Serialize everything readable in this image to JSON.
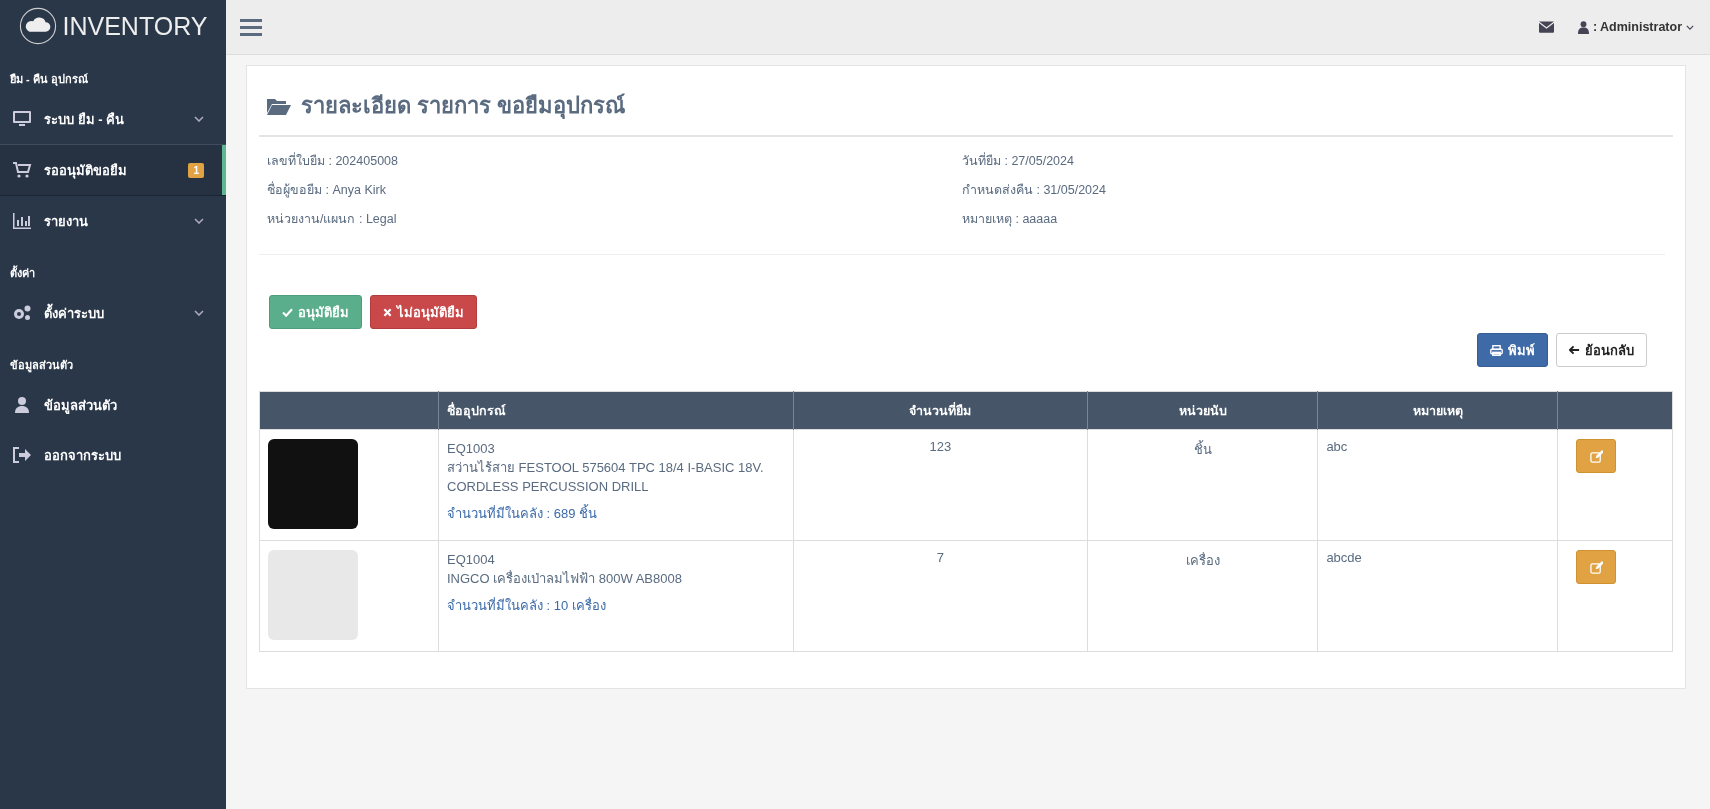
{
  "brand": "INVENTORY",
  "sidebar": {
    "sections": [
      {
        "title": "ยืม - คืน อุปกรณ์",
        "items": [
          {
            "label": "ระบบ ยืม - คืน",
            "kind": "dropdown",
            "selected": false
          },
          {
            "label": "รออนุมัติขอยืม",
            "kind": "link",
            "selected": true,
            "badge": "1"
          },
          {
            "label": "รายงาน",
            "kind": "dropdown",
            "selected": false
          }
        ]
      },
      {
        "title": "ตั้งค่า",
        "items": [
          {
            "label": "ตั้งค่าระบบ",
            "kind": "dropdown",
            "selected": false
          }
        ]
      },
      {
        "title": "ข้อมูลส่วนตัว",
        "items": [
          {
            "label": "ข้อมูลส่วนตัว",
            "kind": "link",
            "selected": false
          },
          {
            "label": "ออกจากระบบ",
            "kind": "link",
            "selected": false
          }
        ]
      }
    ]
  },
  "topbar": {
    "user": ": Administrator"
  },
  "page": {
    "title": "รายละเอียด รายการ ขอยืมอุปกรณ์",
    "details_left": [
      "เลขที่ใบยืม : 202405008",
      "ชื่อผู้ขอยืม : Anya Kirk",
      "หน่วยงาน/แผนก : Legal"
    ],
    "details_right": [
      "วันที่ยืม : 27/05/2024",
      "กำหนดส่งคืน : 31/05/2024",
      "หมายเหตุ : aaaaa"
    ],
    "approve_button": "อนุมัติยืม",
    "reject_button": "ไม่อนุมัติยืม",
    "print_button": "พิมพ์",
    "back_button": "ย้อนกลับ"
  },
  "table": {
    "columns": [
      "ชื่ออุปกรณ์",
      "จำนวนที่ยืม",
      "หน่วยนับ",
      "หมายเหตุ"
    ],
    "rows": [
      {
        "code": "EQ1003",
        "name": "สว่านไร้สาย FESTOOL 575604 TPC 18/4 I-BASIC 18V. CORDLESS PERCUSSION DRILL",
        "stock": "จำนวนที่มีในคลัง : 689 ชิ้น",
        "quantity": "123",
        "unit": "ชิ้น",
        "note": "abc"
      },
      {
        "code": "EQ1004",
        "name": "INGCO เครื่องเป่าลมไฟฟ้า 800W AB8008",
        "stock": "จำนวนที่มีในคลัง : 10 เครื่อง",
        "quantity": "7",
        "unit": "เครื่อง",
        "note": "abcde"
      }
    ]
  }
}
